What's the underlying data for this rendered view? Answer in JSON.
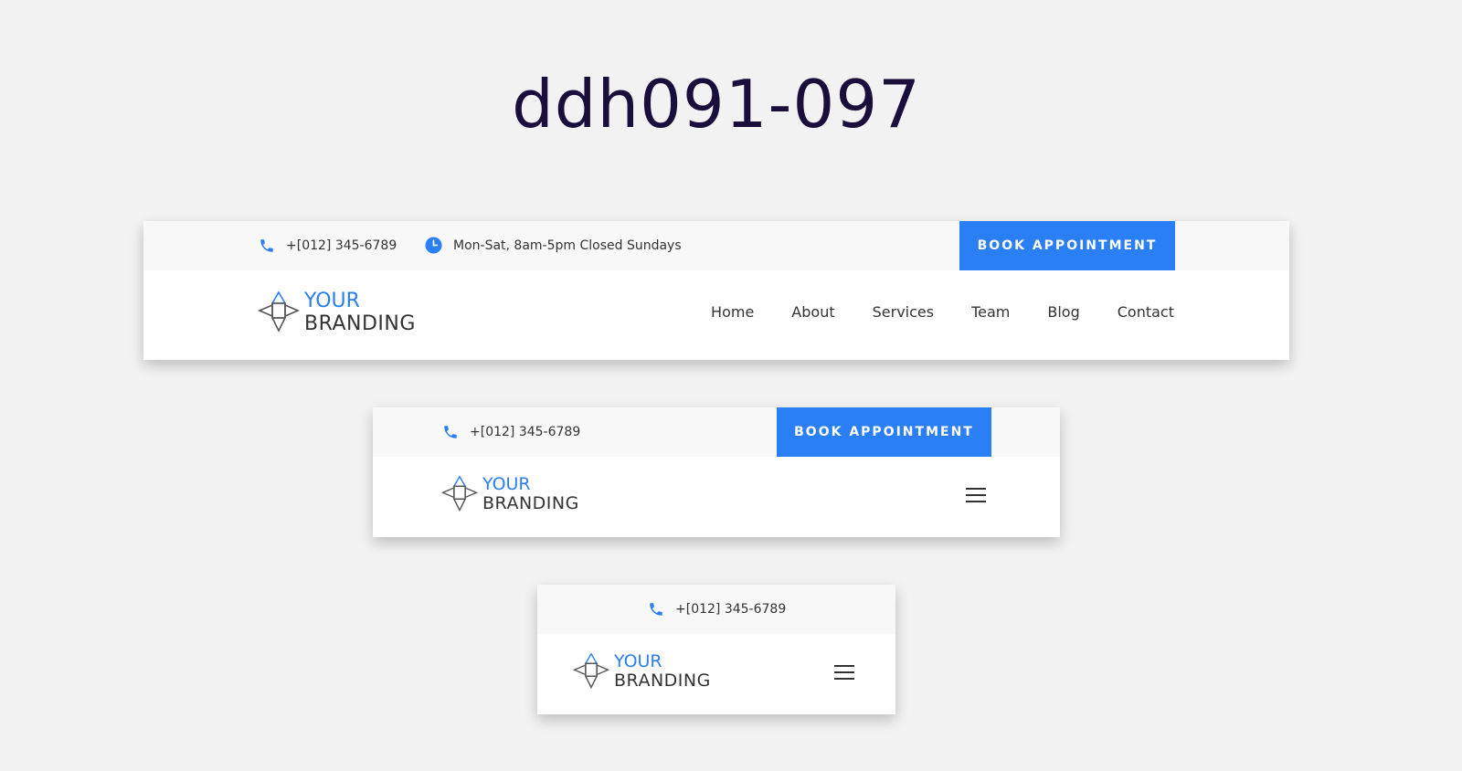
{
  "page": {
    "title": "ddh091-097"
  },
  "contact": {
    "phone": "+[012] 345-6789",
    "hours": "Mon-Sat, 8am-5pm Closed Sundays"
  },
  "cta": {
    "label": "BOOK APPOINTMENT"
  },
  "logo": {
    "line1": "YOUR",
    "line2": "BRANDING"
  },
  "nav": {
    "items": [
      {
        "label": "Home"
      },
      {
        "label": "About"
      },
      {
        "label": "Services"
      },
      {
        "label": "Team"
      },
      {
        "label": "Blog"
      },
      {
        "label": "Contact"
      }
    ]
  },
  "icons": {
    "phone": "phone-icon",
    "clock": "clock-icon",
    "menu": "hamburger-menu-icon"
  },
  "colors": {
    "accent": "#2b7ff5",
    "title": "#1a0f3c",
    "background": "#f2f2f2",
    "topbar": "#f8f8f8"
  }
}
